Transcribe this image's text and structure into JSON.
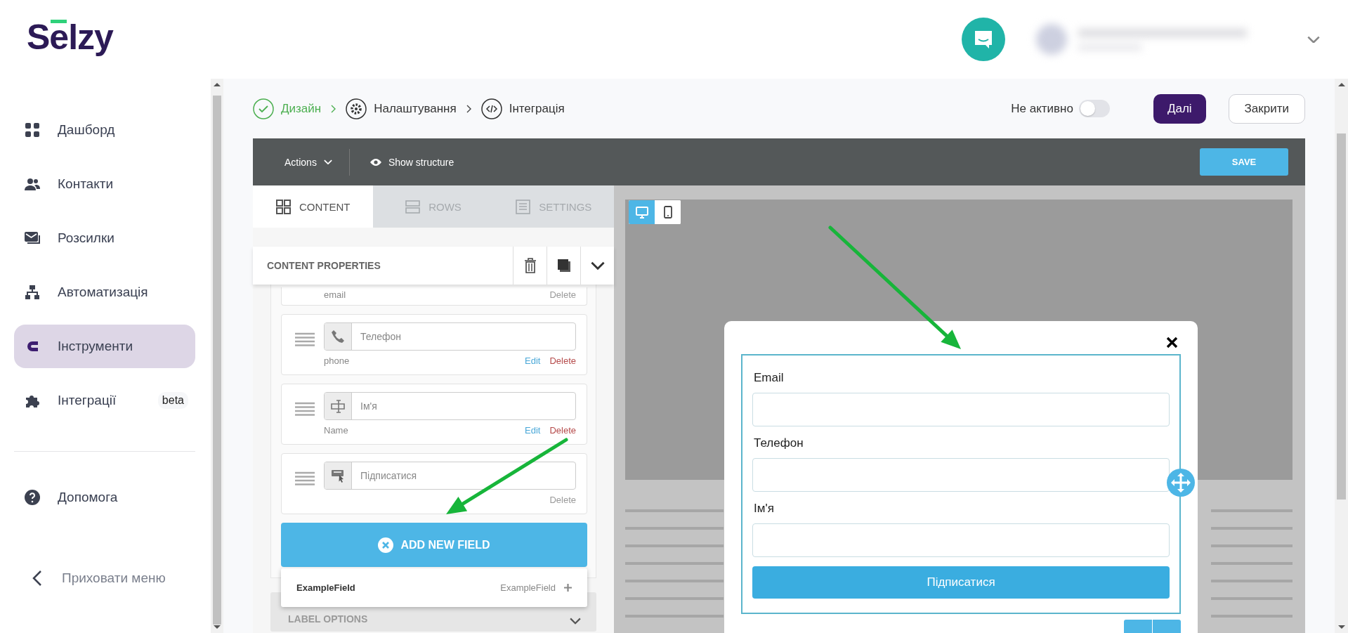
{
  "logo": {
    "text": "Selzy"
  },
  "sidebar": {
    "items": [
      {
        "label": "Дашборд",
        "selected": false
      },
      {
        "label": "Контакти",
        "selected": false
      },
      {
        "label": "Розсилки",
        "selected": false
      },
      {
        "label": "Автоматизація",
        "selected": false
      },
      {
        "label": "Інструменти",
        "selected": true
      },
      {
        "label": "Інтеграції",
        "selected": false,
        "badge": "beta"
      }
    ],
    "help": "Допомога",
    "hide_menu": "Приховати меню"
  },
  "steps": [
    {
      "label": "Дизайн",
      "done": true
    },
    {
      "label": "Налаштування",
      "done": false
    },
    {
      "label": "Інтеграція",
      "done": false
    }
  ],
  "status": {
    "label": "Не активно",
    "on": false
  },
  "buttons": [
    {
      "label": "Далі",
      "kind": "primary"
    },
    {
      "label": "Закрити",
      "kind": "secondary"
    }
  ],
  "editor_toolbar": {
    "actions": "Actions",
    "show_structure": "Show structure",
    "save": "SAVE"
  },
  "panel_tabs": [
    {
      "label": "CONTENT",
      "selected": true
    },
    {
      "label": "ROWS",
      "selected": false
    },
    {
      "label": "SETTINGS",
      "selected": false
    }
  ],
  "content_properties": {
    "title": "CONTENT PROPERTIES"
  },
  "fields": [
    {
      "name": "email",
      "delete": "Delete",
      "delete_disabled": true
    },
    {
      "kind": "phone",
      "placeholder": "Телефон",
      "name": "phone",
      "edit": "Edit",
      "delete": "Delete",
      "delete_disabled": false
    },
    {
      "kind": "text",
      "placeholder": "Ім'я",
      "name": "Name",
      "edit": "Edit",
      "delete": "Delete",
      "delete_disabled": false
    },
    {
      "kind": "button",
      "placeholder": "Підписатися",
      "delete": "Delete",
      "delete_disabled": true
    }
  ],
  "add_field_button": "ADD NEW FIELD",
  "suggestion": {
    "label": "ExampleField",
    "name": "ExampleField"
  },
  "label_options": "LABEL OPTIONS",
  "preview": {
    "devices": [
      {
        "kind": "desktop",
        "selected": true
      },
      {
        "kind": "mobile",
        "selected": false
      }
    ],
    "form": {
      "fields": [
        {
          "label": "Email"
        },
        {
          "label": "Телефон"
        },
        {
          "label": "Ім'я"
        }
      ],
      "submit": "Підписатися"
    }
  }
}
